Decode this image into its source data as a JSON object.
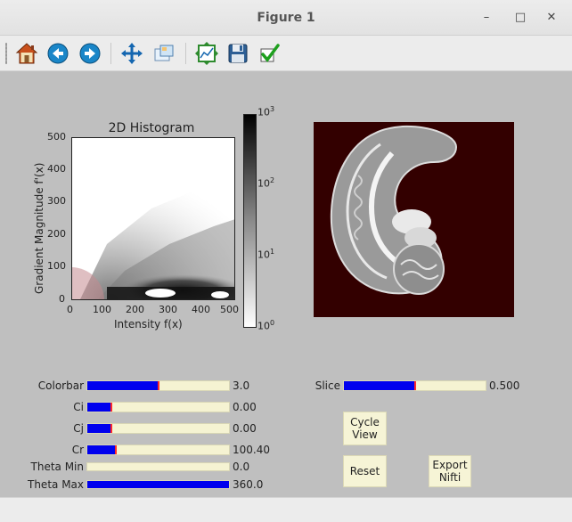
{
  "window": {
    "title": "Figure 1"
  },
  "titlebar_buttons": {
    "minimize": "–",
    "maximize": "□",
    "close": "✕"
  },
  "toolbar": {
    "items": [
      {
        "icon": "home-icon",
        "tooltip": "Home"
      },
      {
        "icon": "back-arrow-icon",
        "tooltip": "Back"
      },
      {
        "icon": "forward-arrow-icon",
        "tooltip": "Forward"
      },
      {
        "icon": "pan-move-icon",
        "tooltip": "Pan"
      },
      {
        "icon": "zoom-rectangle-icon",
        "tooltip": "Zoom"
      },
      {
        "icon": "subplots-config-icon",
        "tooltip": "Subplots"
      },
      {
        "icon": "save-floppy-icon",
        "tooltip": "Save"
      },
      {
        "icon": "checkmark-edit-icon",
        "tooltip": "Edit"
      }
    ]
  },
  "histogram": {
    "title": "2D Histogram",
    "xlabel": "Intensity f(x)",
    "ylabel": "Gradient Magnitude f'(x)",
    "xticks": [
      "0",
      "100",
      "200",
      "300",
      "400",
      "500"
    ],
    "yticks": [
      "0",
      "100",
      "200",
      "300",
      "400",
      "500"
    ],
    "xlim": [
      0,
      500
    ],
    "ylim": [
      0,
      500
    ],
    "colorbar": {
      "scale": "log",
      "ticks": [
        "10",
        "10",
        "10",
        "10"
      ],
      "exponents": [
        "0",
        "1",
        "2",
        "3"
      ],
      "range": [
        1,
        1000
      ]
    }
  },
  "brain_view": {
    "background_color": "#330000"
  },
  "sliders": [
    {
      "label": "Colorbar",
      "value_text": "3.0",
      "fraction": 0.5
    },
    {
      "label": "Ci",
      "value_text": "0.00",
      "fraction": 0.17
    },
    {
      "label": "Cj",
      "value_text": "0.00",
      "fraction": 0.17
    },
    {
      "label": "Cr",
      "value_text": "100.40",
      "fraction": 0.2
    },
    {
      "label": "Theta Min",
      "value_text": "0.0",
      "fraction": 0.0
    },
    {
      "label": "Theta Max",
      "value_text": "360.0",
      "fraction": 1.0
    }
  ],
  "slice": {
    "label": "Slice",
    "value_text": "0.500",
    "fraction": 0.5
  },
  "buttons": {
    "cycle_view_line1": "Cycle",
    "cycle_view_line2": "View",
    "reset": "Reset",
    "export_line1": "Export",
    "export_line2": "Nifti"
  },
  "colors": {
    "slider_fill": "#0000ee",
    "slider_track": "#f5f3d2",
    "slider_marker": "#ff2a2a",
    "figure_bg": "#bfbfbf"
  }
}
